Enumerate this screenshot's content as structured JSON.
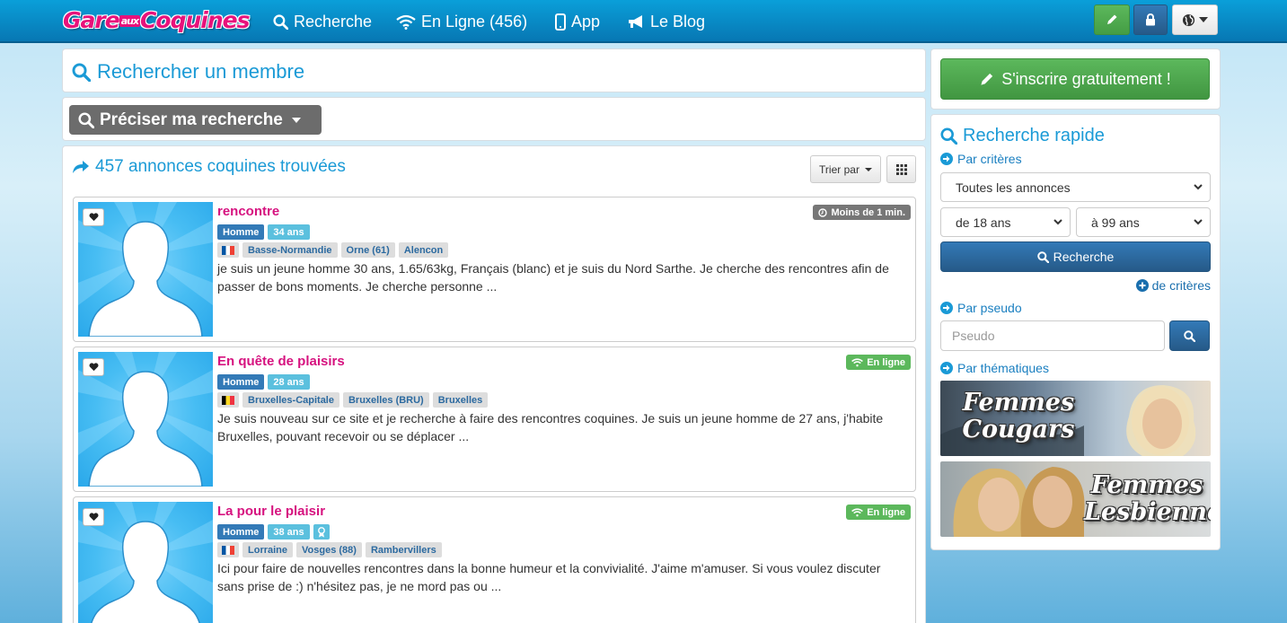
{
  "nav": {
    "logo_part1": "Gare",
    "logo_aux": "aux",
    "logo_part2": "Coquines",
    "links": [
      {
        "label": "Recherche",
        "icon": "search-icon"
      },
      {
        "label": "En Ligne (456)",
        "icon": "wifi-icon"
      },
      {
        "label": "App",
        "icon": "mobile-icon"
      },
      {
        "label": "Le Blog",
        "icon": "bullhorn-icon"
      }
    ],
    "buttons": [
      {
        "icon": "pencil-icon",
        "color": "#4cae4c"
      },
      {
        "icon": "lock-icon",
        "color": "#337ab7"
      },
      {
        "icon": "globe-icon",
        "color": "#ffffff"
      }
    ]
  },
  "search_member": {
    "title": "Rechercher un membre"
  },
  "refine": {
    "label": "Préciser ma recherche"
  },
  "results": {
    "title": "457 annonces coquines trouvées",
    "sort_label": "Trier par"
  },
  "cards": [
    {
      "title": "rencontre",
      "status": "Moins de 1 min.",
      "status_type": "time",
      "sex": "Homme",
      "age": "34 ans",
      "flag": "FR",
      "locations": [
        "Basse-Normandie",
        "Orne (61)",
        "Alencon"
      ],
      "description": "je suis un jeune homme 30 ans, 1.65/63kg, Français (blanc) et je suis du Nord Sarthe. Je cherche des rencontres afin de passer de bons moments. Je cherche personne ..."
    },
    {
      "title": "En quête de plaisirs",
      "status": "En ligne",
      "status_type": "online",
      "sex": "Homme",
      "age": "28 ans",
      "flag": "BE",
      "locations": [
        "Bruxelles-Capitale",
        "Bruxelles (BRU)",
        "Bruxelles"
      ],
      "description": "Je suis nouveau sur ce site et je recherche à faire des rencontres coquines. Je suis un jeune homme de 27 ans, j'habite Bruxelles, pouvant recevoir ou se déplacer ..."
    },
    {
      "title": "La pour le plaisir",
      "status": "En ligne",
      "status_type": "online",
      "sex": "Homme",
      "age": "38 ans",
      "flag": "FR",
      "locations": [
        "Lorraine",
        "Vosges (88)",
        "Rambervillers"
      ],
      "description": "Ici pour faire de nouvelles rencontres dans la bonne humeur et la convivialité. J'aime m'amuser. Si vous voulez discuter sans prise de :) n'hésitez pas, je ne mord pas ou ..."
    }
  ],
  "sidebar": {
    "signup_label": "S'inscrire gratuitement !",
    "quick_search_title": "Recherche rapide",
    "by_criteria": "Par critères",
    "ad_type_selected": "Toutes les annonces",
    "age_from_selected": "de 18 ans",
    "age_to_selected": "à 99 ans",
    "search_button": "Recherche",
    "more_criteria": "de critères",
    "by_pseudo": "Par pseudo",
    "pseudo_placeholder": "Pseudo",
    "by_theme": "Par thématiques",
    "themes": [
      {
        "line1": "Femmes",
        "line2": "Cougars"
      },
      {
        "line1": "Femmes",
        "line2": "Lesbiennes"
      }
    ]
  }
}
